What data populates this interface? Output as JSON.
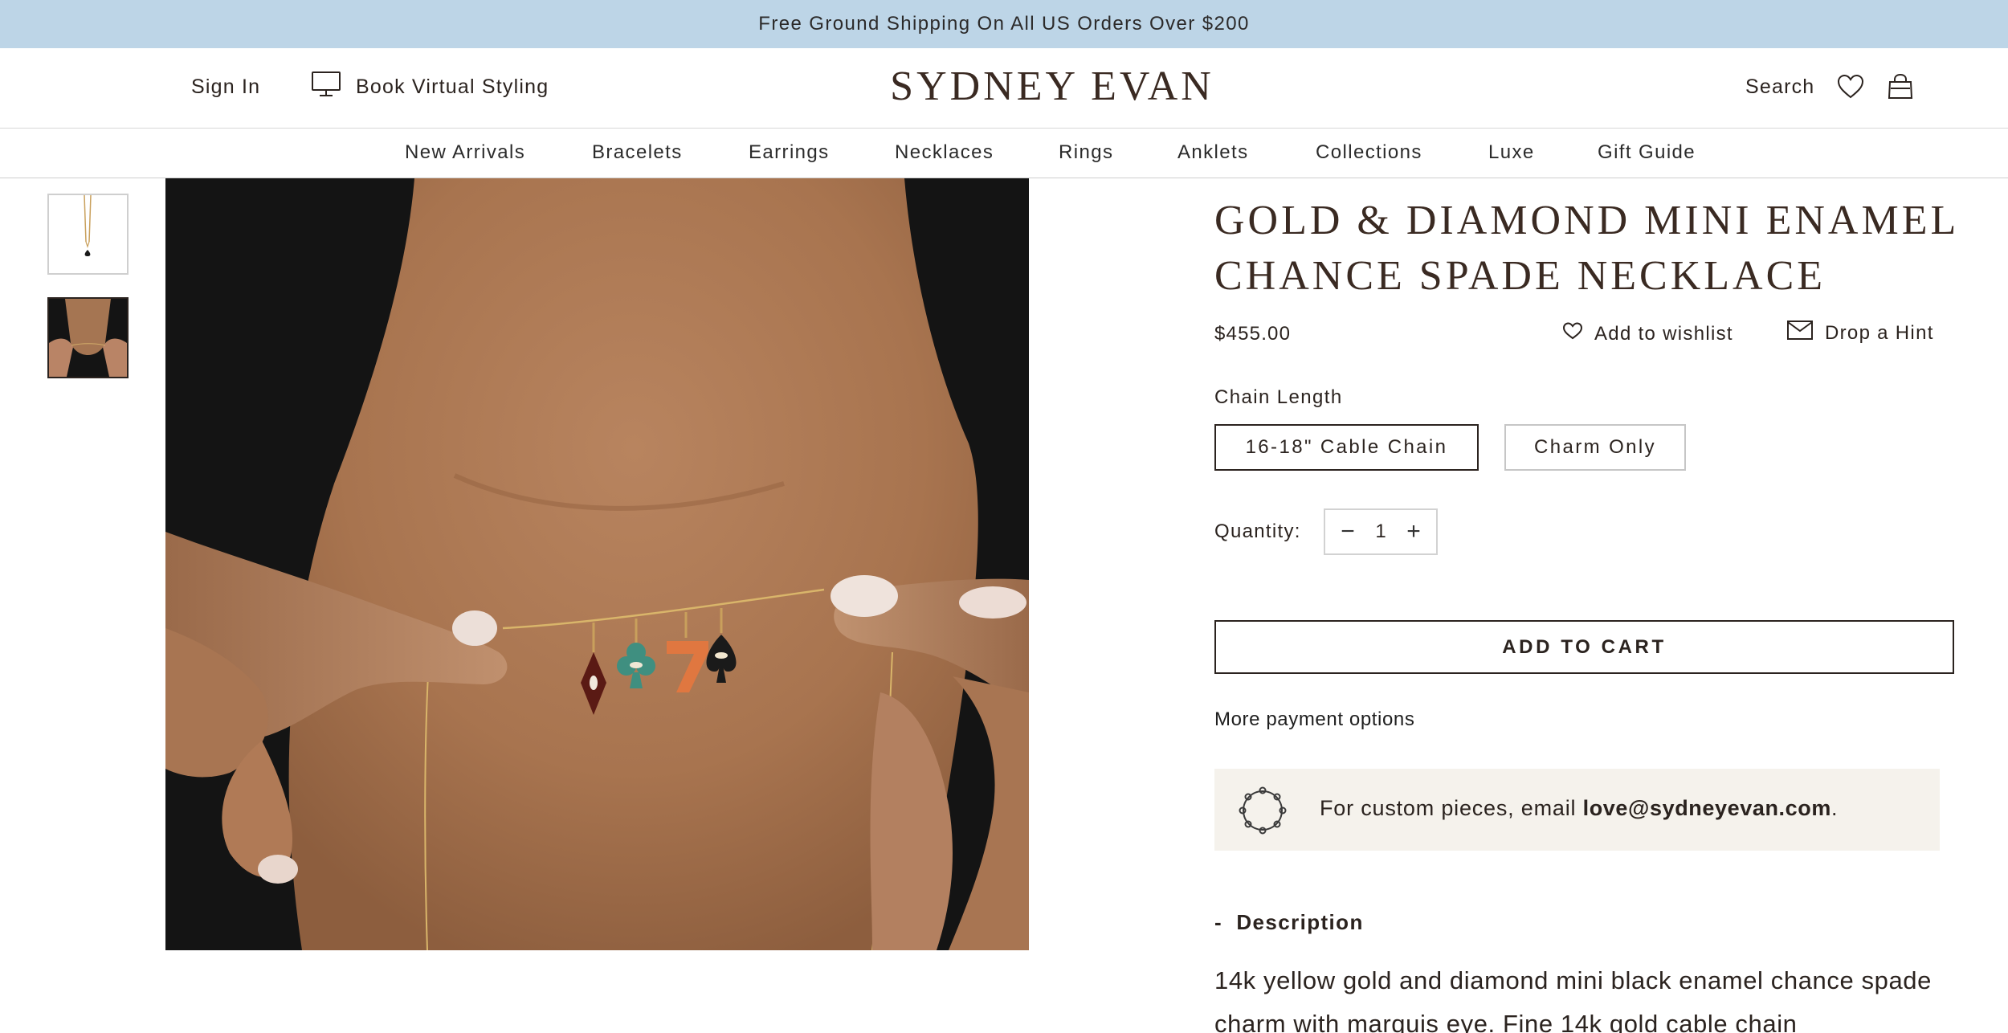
{
  "announcement": "Free Ground Shipping On All US Orders Over $200",
  "header": {
    "sign_in": "Sign In",
    "virtual_styling": "Book Virtual Styling",
    "logo": "SYDNEY EVAN",
    "search": "Search"
  },
  "nav": {
    "items": [
      "New Arrivals",
      "Bracelets",
      "Earrings",
      "Necklaces",
      "Rings",
      "Anklets",
      "Collections",
      "Luxe",
      "Gift Guide"
    ]
  },
  "product": {
    "title": "GOLD & DIAMOND MINI ENAMEL CHANCE SPADE NECKLACE",
    "price": "$455.00",
    "add_to_wishlist": "Add to wishlist",
    "drop_hint": "Drop a Hint",
    "chain_length_label": "Chain Length",
    "options": [
      "16-18\" Cable Chain",
      "Charm Only"
    ],
    "selected_option": "16-18\" Cable Chain",
    "quantity_label": "Quantity:",
    "quantity": "1",
    "add_to_cart": "ADD TO CART",
    "more_payment": "More payment options",
    "custom_prefix": "For custom pieces, email ",
    "custom_email": "love@sydneyevan.com",
    "custom_suffix": ".",
    "description_toggle": "-",
    "description_heading": "Description",
    "description_text": "14k yellow gold and diamond mini black enamel chance spade charm with marquis eye. Fine 14k gold cable chain"
  },
  "colors": {
    "announcement_bg": "#bdd5e7",
    "text_dark": "#2b231f",
    "custom_bg": "#f5f2ec"
  },
  "icons": [
    "monitor-icon",
    "heart-icon",
    "bag-icon",
    "mail-icon",
    "bracelet-icon",
    "minus-icon",
    "plus-icon"
  ]
}
